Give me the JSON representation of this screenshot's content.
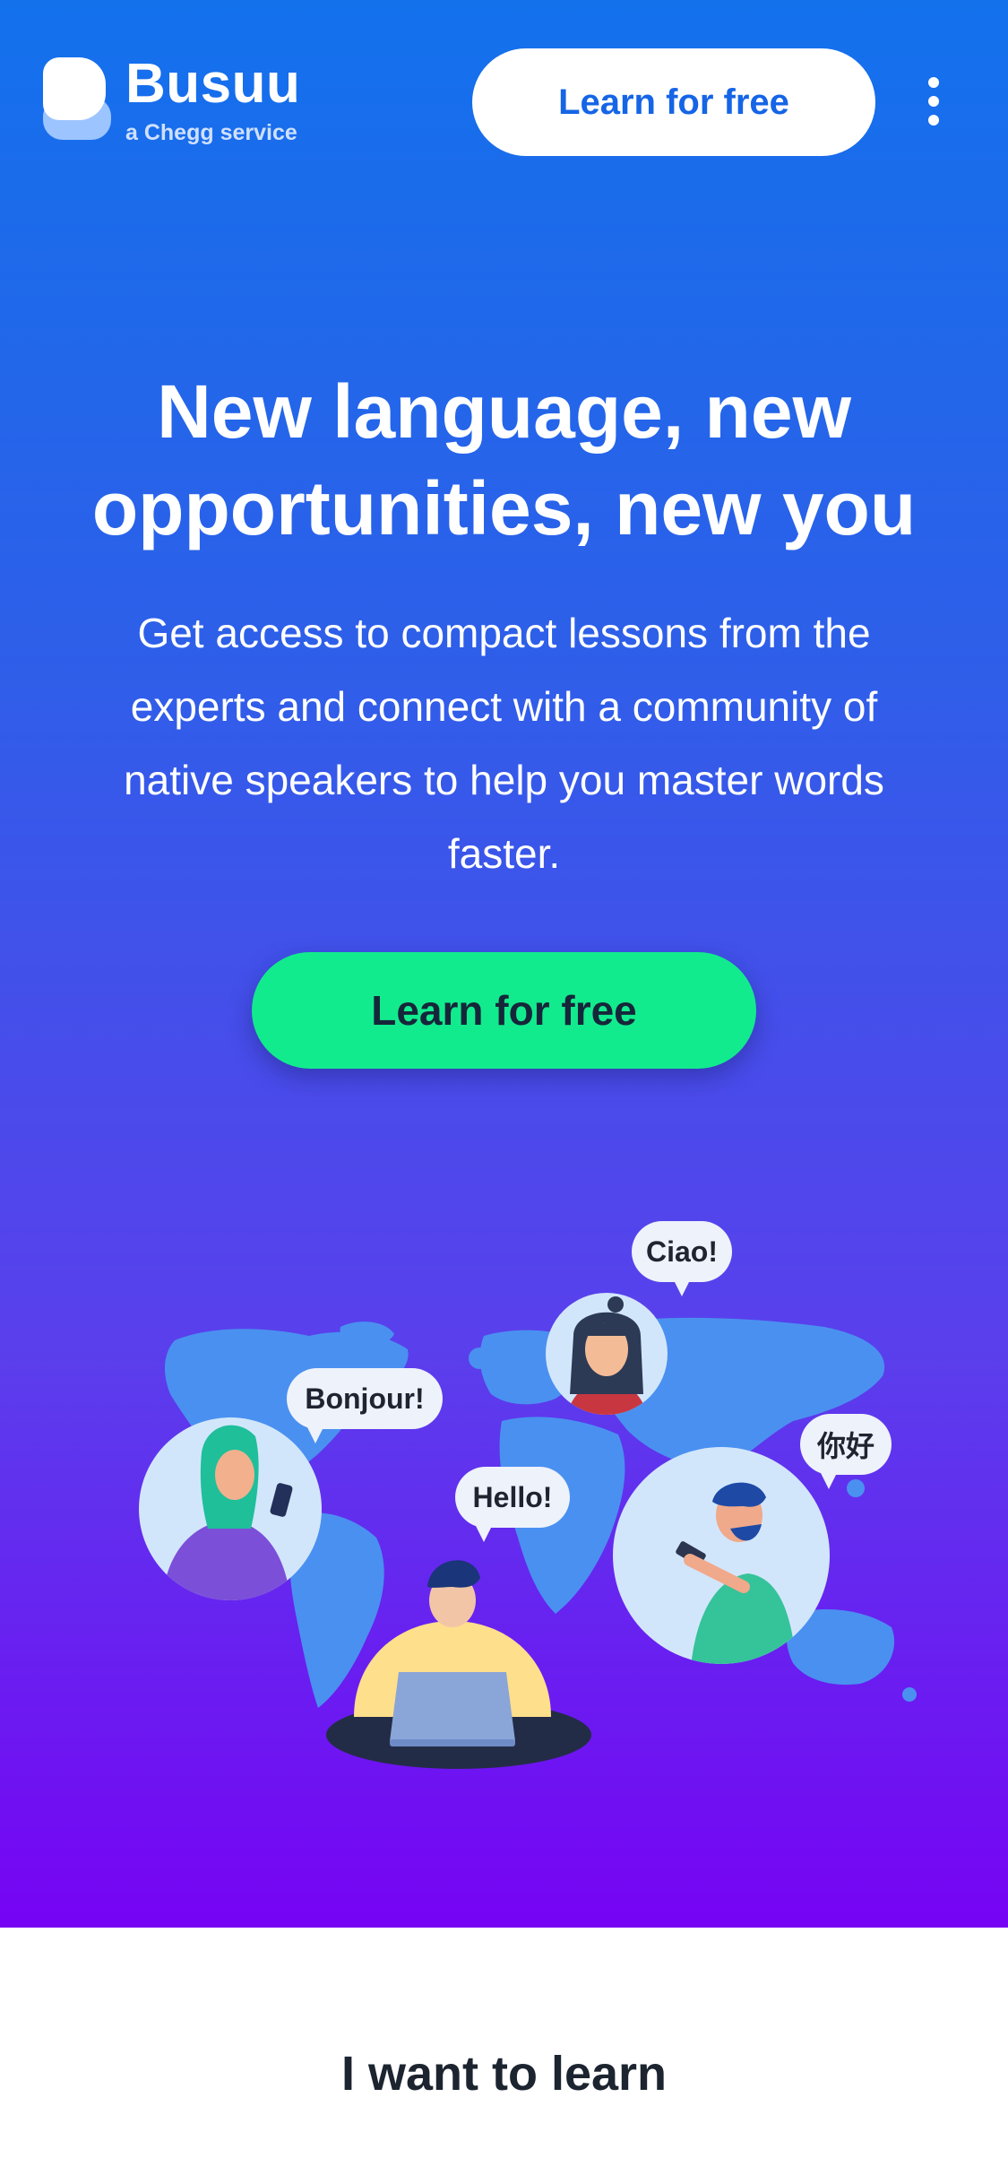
{
  "header": {
    "brand_name": "Busuu",
    "brand_sub": "a Chegg service",
    "cta_label": "Learn for free",
    "menu_icon": "kebab-menu-icon"
  },
  "hero": {
    "title": "New language, new opportunities, new you",
    "description": "Get access to compact lessons from the experts and connect with a community of native speakers to help you master words faster.",
    "cta_label": "Learn for free"
  },
  "illustration": {
    "greetings": {
      "ciao": "Ciao!",
      "bonjour": "Bonjour!",
      "hello": "Hello!",
      "nihao": "你好"
    }
  },
  "section": {
    "title": "I want to learn"
  },
  "colors": {
    "hero_gradient_top": "#1371ec",
    "hero_gradient_bottom": "#7603f4",
    "cta_green": "#12eb8d",
    "brand_blue": "#1565e6"
  }
}
